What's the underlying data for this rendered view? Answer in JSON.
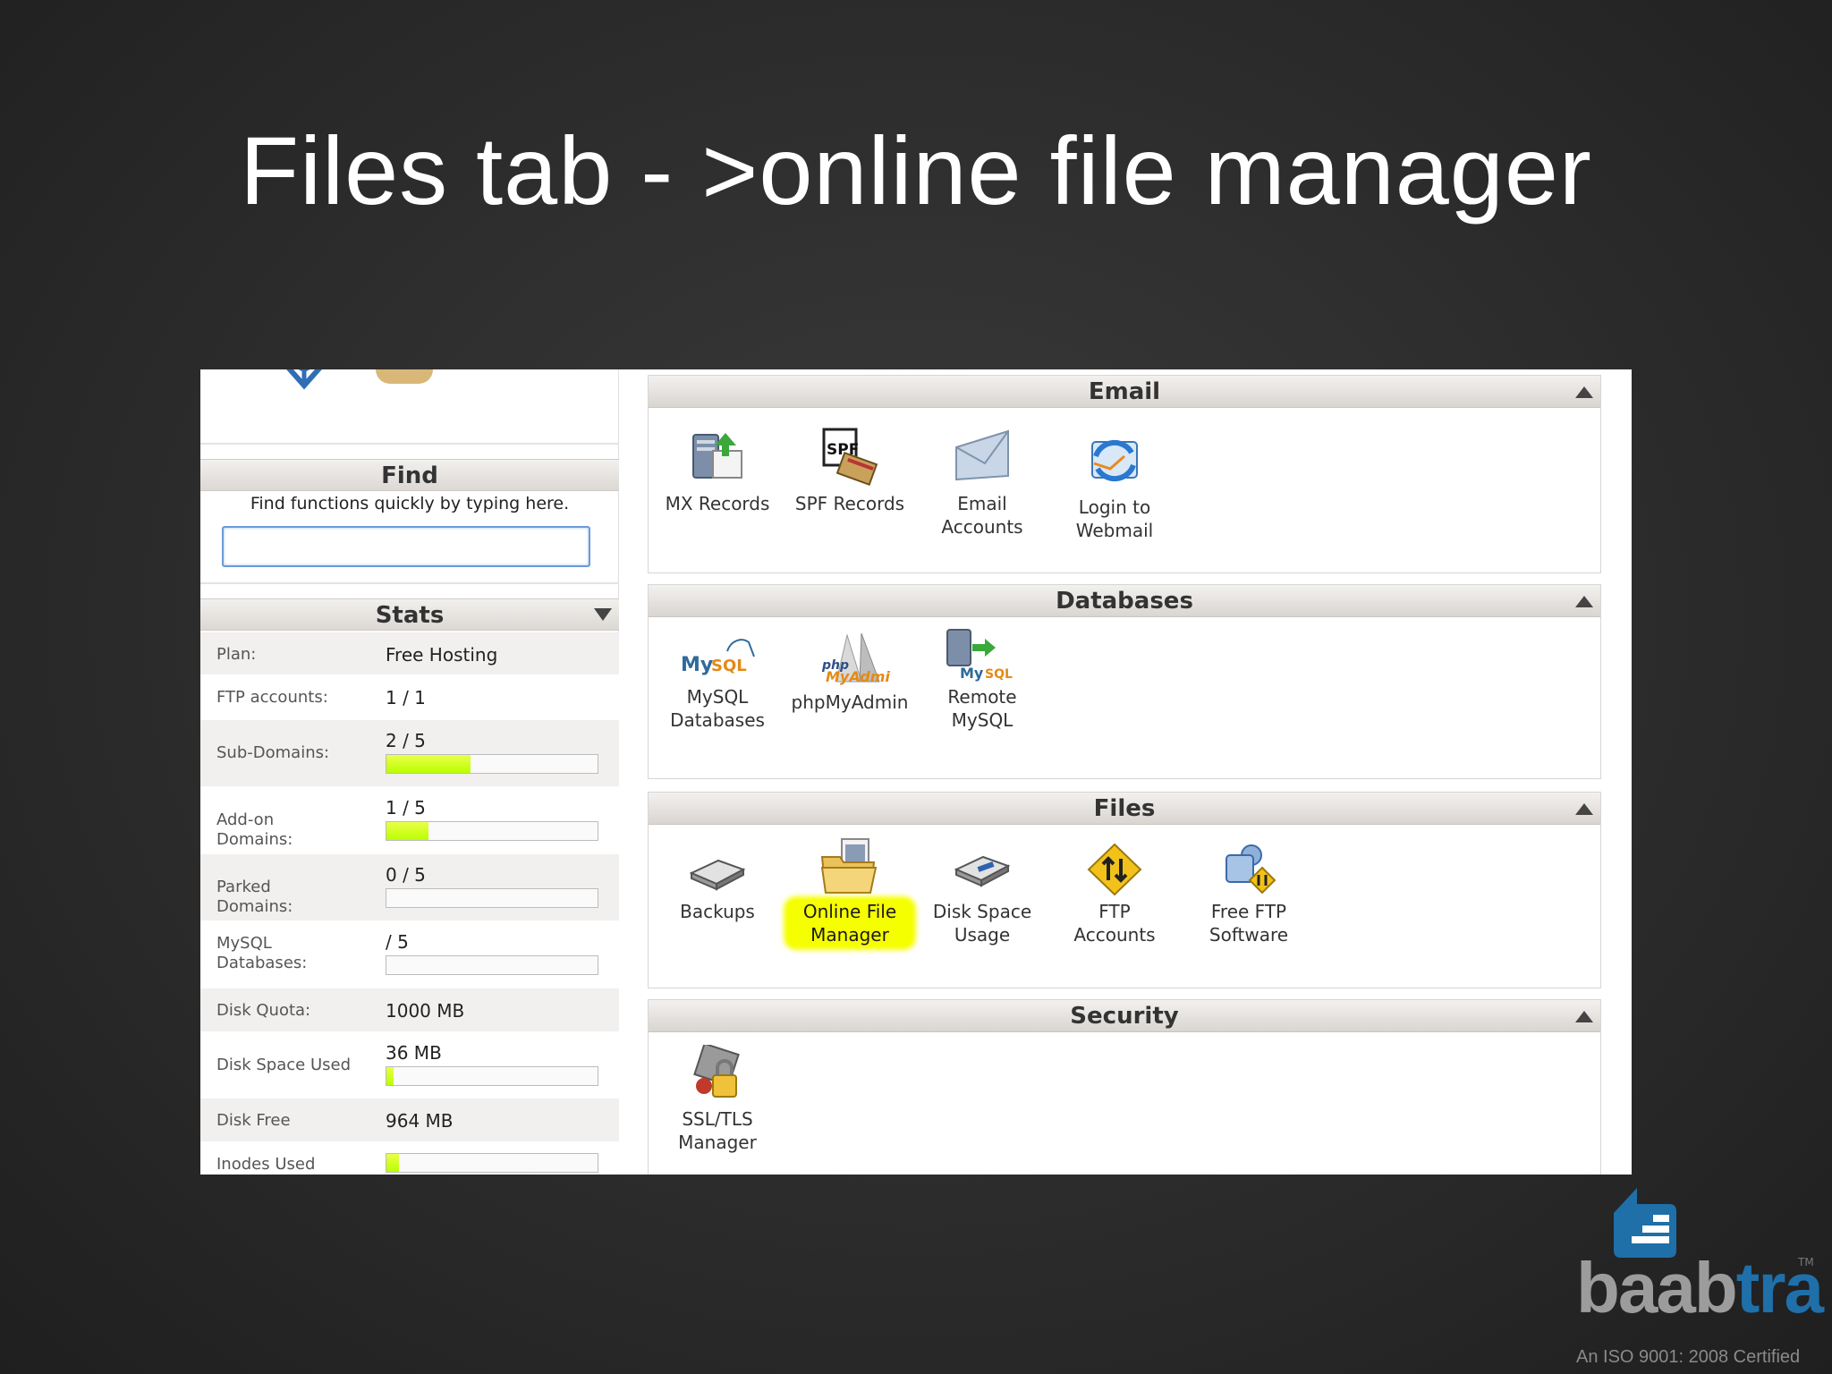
{
  "slide": {
    "title": "Files tab - >online file manager"
  },
  "find": {
    "title": "Find",
    "hint": "Find functions quickly by typing here.",
    "value": ""
  },
  "stats": {
    "title": "Stats",
    "rows": [
      {
        "label": "Plan:",
        "value": "Free Hosting"
      },
      {
        "label": "FTP accounts:",
        "value": "1 / 1"
      },
      {
        "label": "Sub-Domains:",
        "value": "2 / 5",
        "usage": 0.4
      },
      {
        "label": "Add-on Domains:",
        "value": "1 / 5",
        "usage": 0.2
      },
      {
        "label": "Parked Domains:",
        "value": "0 / 5",
        "usage": 0
      },
      {
        "label": "MySQL Databases:",
        "value": "/ 5",
        "usage": 0
      },
      {
        "label": "Disk Quota:",
        "value": "1000 MB"
      },
      {
        "label": "Disk Space Used",
        "value": "36 MB",
        "usage": 0.036
      },
      {
        "label": "Disk Free",
        "value": "964 MB"
      },
      {
        "label": "Inodes Used",
        "value": "",
        "usage": 0.06
      }
    ]
  },
  "panels": {
    "email": {
      "title": "Email",
      "items": [
        {
          "label": "MX Records",
          "icon": "mx-records-icon"
        },
        {
          "label": "SPF Records",
          "icon": "spf-records-icon"
        },
        {
          "label": "Email Accounts",
          "icon": "email-accounts-icon"
        },
        {
          "label": "Login to Webmail",
          "icon": "webmail-icon"
        }
      ]
    },
    "databases": {
      "title": "Databases",
      "items": [
        {
          "label": "MySQL Databases",
          "icon": "mysql-icon"
        },
        {
          "label": "phpMyAdmin",
          "icon": "phpmyadmin-icon"
        },
        {
          "label": "Remote MySQL",
          "icon": "remote-mysql-icon"
        }
      ]
    },
    "files": {
      "title": "Files",
      "items": [
        {
          "label": "Backups",
          "icon": "backups-icon"
        },
        {
          "label": "Online File Manager",
          "icon": "file-manager-icon",
          "highlighted": true
        },
        {
          "label": "Disk Space Usage",
          "icon": "disk-usage-icon"
        },
        {
          "label": "FTP Accounts",
          "icon": "ftp-accounts-icon"
        },
        {
          "label": "Free FTP Software",
          "icon": "ftp-software-icon"
        }
      ]
    },
    "security": {
      "title": "Security",
      "items": [
        {
          "label": "SSL/TLS Manager",
          "icon": "ssl-tls-icon"
        }
      ]
    }
  },
  "brand": {
    "name_gray": "baab",
    "name_blue": "tra",
    "tm": "TM",
    "certification": "An ISO 9001: 2008 Certified"
  },
  "colors": {
    "highlight": "#f6ff00",
    "usage_bar": "#b9ff00",
    "brand_blue": "#1f6fa9"
  }
}
